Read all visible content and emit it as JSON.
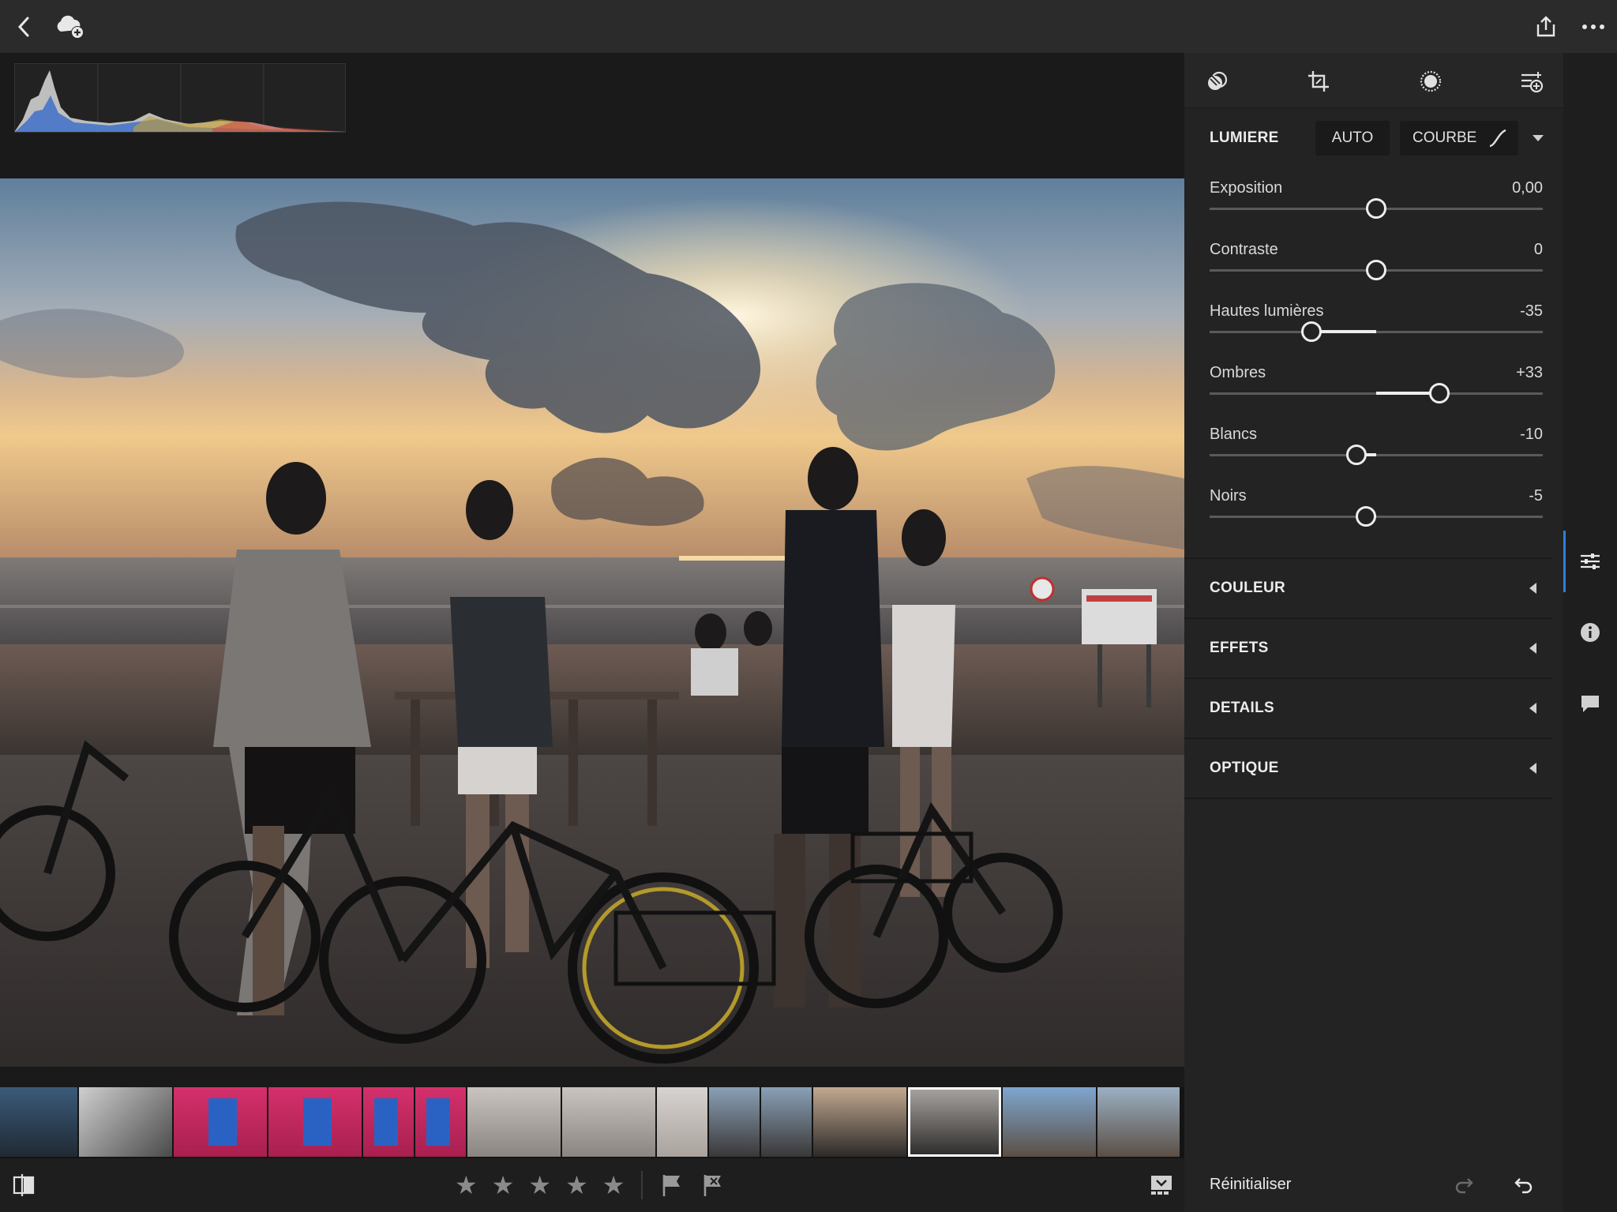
{
  "top_bar": {
    "back_icon": "chevron-left-icon",
    "cloud_icon": "cloud-add-icon",
    "share_icon": "share-icon",
    "more_icon": "more-horizontal-icon"
  },
  "panel_tools": [
    "edit-bands-icon",
    "crop-icon",
    "selective-brush-icon",
    "presets-icon"
  ],
  "light_section": {
    "title": "LUMIERE",
    "auto_label": "AUTO",
    "curve_label": "COURBE",
    "sliders": [
      {
        "label": "Exposition",
        "value": "0,00",
        "position": 0.5
      },
      {
        "label": "Contraste",
        "value": "0",
        "position": 0.5
      },
      {
        "label": "Hautes lumières",
        "value": "-35",
        "position": 0.305
      },
      {
        "label": "Ombres",
        "value": "+33",
        "position": 0.69
      },
      {
        "label": "Blancs",
        "value": "-10",
        "position": 0.44
      },
      {
        "label": "Noirs",
        "value": "-5",
        "position": 0.47
      }
    ]
  },
  "collapsed_sections": [
    {
      "title": "COULEUR"
    },
    {
      "title": "EFFETS"
    },
    {
      "title": "DETAILS"
    },
    {
      "title": "OPTIQUE"
    }
  ],
  "footer": {
    "reset_label": "Réinitialiser",
    "redo_icon": "redo-icon",
    "undo_icon": "undo-icon"
  },
  "rating": {
    "stars": 5,
    "filled": 0
  },
  "colors": {
    "accent": "#2f7de1",
    "panel_bg": "#232323",
    "slider_fill": "#ededed"
  }
}
